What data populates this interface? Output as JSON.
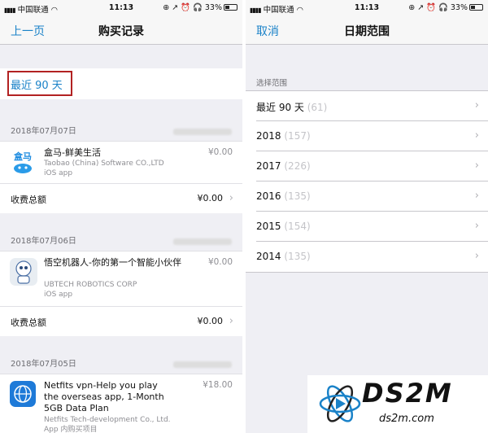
{
  "left": {
    "status": {
      "carrier": "中国联通",
      "time": "11:13",
      "icons": "⊕ ↗ ⏰ 🎧",
      "battery": "33%"
    },
    "nav": {
      "back_label": "上一页",
      "title": "购买记录"
    },
    "range_label": "最近 90 天",
    "groups": [
      {
        "date": "2018年07月07日",
        "app_name": "盒马-鲜美生活",
        "app_sub": [
          "Taobao (China) Software CO.,LTD",
          "iOS app"
        ],
        "price": "¥0.00",
        "total_label": "收费总额",
        "total_value": "¥0.00"
      },
      {
        "date": "2018年07月06日",
        "app_name": "悟空机器人-你的第一个智能小伙伴",
        "app_sub": [
          "UBTECH ROBOTICS CORP",
          "iOS app"
        ],
        "price": "¥0.00",
        "total_label": "收费总额",
        "total_value": "¥0.00"
      },
      {
        "date": "2018年07月05日",
        "app_name": "Netfits vpn-Help you play the overseas app, 1-Month 5GB Data Plan",
        "app_sub": [
          "Netfits Tech-development Co., Ltd.",
          "App 内购买项目"
        ],
        "price": "¥18.00"
      }
    ]
  },
  "right": {
    "status": {
      "carrier": "中国联通",
      "time": "11:13",
      "icons": "⊕ ↗ ⏰ 🎧",
      "battery": "33%"
    },
    "nav": {
      "cancel_label": "取消",
      "title": "日期范围"
    },
    "section_header": "选择范围",
    "ranges": [
      {
        "label": "最近 90 天",
        "count": "(61)"
      },
      {
        "label": "2018",
        "count": "(157)"
      },
      {
        "label": "2017",
        "count": "(226)"
      },
      {
        "label": "2016",
        "count": "(135)"
      },
      {
        "label": "2015",
        "count": "(154)"
      },
      {
        "label": "2014",
        "count": "(135)"
      }
    ]
  },
  "watermark": {
    "text": "DS2M",
    "sub": "ds2m.com"
  },
  "colors": {
    "accent": "#1a82c8",
    "highlight_border": "#b22222"
  },
  "icons": {
    "app1": "hema-app-icon",
    "app2": "alpha-robot-app-icon",
    "app3": "netfits-app-icon",
    "chevron": "chevron-right-icon"
  }
}
